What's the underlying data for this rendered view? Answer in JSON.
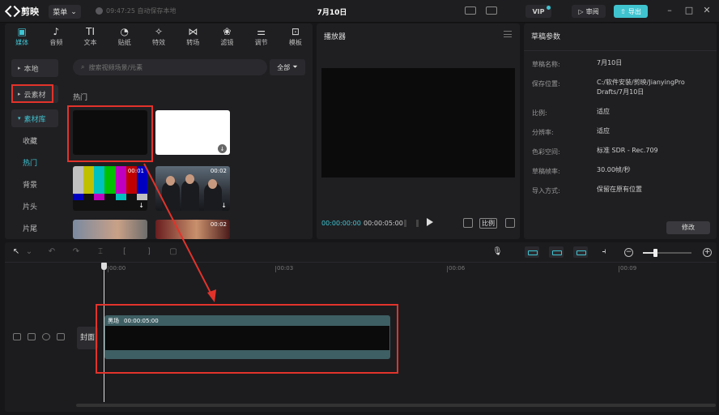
{
  "app": {
    "name": "剪映",
    "menu_label": "菜单",
    "autosave": "09:47:25 自动保存本地",
    "doc_title": "7月10日"
  },
  "header": {
    "vip": "VIP",
    "review": "审阅",
    "export": "导出"
  },
  "tabs": [
    {
      "label": "媒体",
      "icon": "▣"
    },
    {
      "label": "音频",
      "icon": "♪"
    },
    {
      "label": "文本",
      "icon": "TI"
    },
    {
      "label": "贴纸",
      "icon": "◔"
    },
    {
      "label": "特效",
      "icon": "✧"
    },
    {
      "label": "转场",
      "icon": "⋈"
    },
    {
      "label": "滤镜",
      "icon": "❀"
    },
    {
      "label": "调节",
      "icon": "⚌"
    },
    {
      "label": "模板",
      "icon": "⊡"
    }
  ],
  "sidebar": {
    "items": [
      {
        "label": "本地"
      },
      {
        "label": "云素材"
      },
      {
        "label": "素材库"
      },
      {
        "label": "收藏"
      },
      {
        "label": "热门"
      },
      {
        "label": "背景"
      },
      {
        "label": "片头"
      },
      {
        "label": "片尾"
      }
    ]
  },
  "search": {
    "placeholder": "搜索视频场景/元素"
  },
  "filter": {
    "label": "全部"
  },
  "media": {
    "section": "热门",
    "thumbs": [
      {
        "duration": ""
      },
      {
        "duration": ""
      },
      {
        "duration": "00:01"
      },
      {
        "duration": "00:02"
      },
      {
        "duration": ""
      },
      {
        "duration": "00:02"
      }
    ]
  },
  "player": {
    "title": "播放器",
    "current_time": "00:00:00:00",
    "total_time": "00:00:05:00",
    "ratio": "比例"
  },
  "props": {
    "title": "草稿参数",
    "rows": [
      {
        "label": "草稿名称:",
        "value": "7月10日"
      },
      {
        "label": "保存位置:",
        "value": "C:/软件安装/剪映/JianyingPro Drafts/7月10日"
      },
      {
        "label": "比例:",
        "value": "适应"
      },
      {
        "label": "分辨率:",
        "value": "适应"
      },
      {
        "label": "色彩空间:",
        "value": "标准 SDR - Rec.709"
      },
      {
        "label": "草稿帧率:",
        "value": "30.00帧/秒"
      },
      {
        "label": "导入方式:",
        "value": "保留在原有位置"
      }
    ],
    "modify": "修改"
  },
  "timeline": {
    "ruler": [
      "00:00",
      "00:03",
      "00:06",
      "00:09"
    ],
    "cover": "封面",
    "clip": {
      "name": "黑场",
      "duration": "00:00:05:00"
    },
    "zoom_level": 0.25
  },
  "colors": {
    "accent": "#3fc5d3",
    "highlight": "#e2332b"
  }
}
